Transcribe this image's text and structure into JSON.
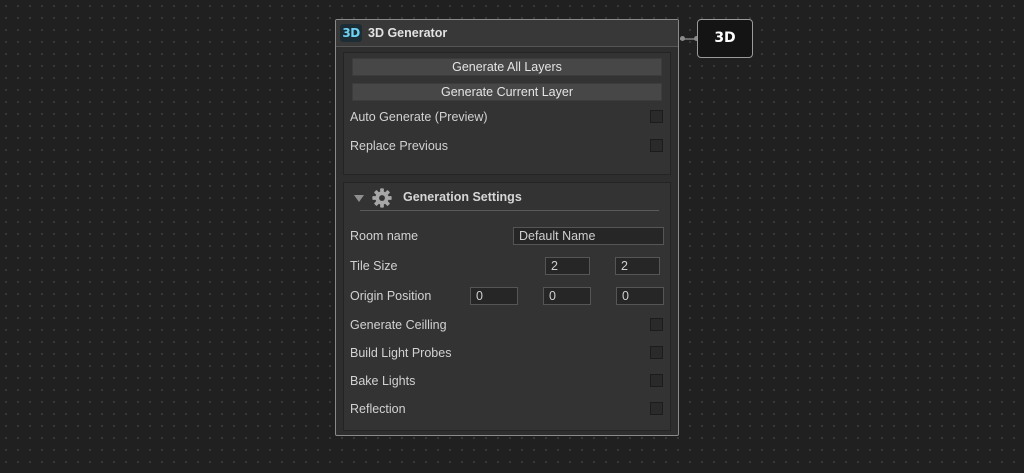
{
  "node": {
    "icon_text": "3D",
    "title": "3D Generator",
    "buttons": {
      "generate_all": "Generate All Layers",
      "generate_current": "Generate Current Layer"
    },
    "toggles": {
      "auto_generate": "Auto Generate (Preview)",
      "replace_previous": "Replace Previous"
    },
    "settings": {
      "title": "Generation Settings",
      "room_name_label": "Room name",
      "room_name_value": "Default Name",
      "tile_size_label": "Tile Size",
      "tile_size_x": "2",
      "tile_size_y": "2",
      "origin_label": "Origin Position",
      "origin_x": "0",
      "origin_y": "0",
      "origin_z": "0",
      "generate_ceiling": "Generate Ceilling",
      "build_light_probes": "Build Light Probes",
      "bake_lights": "Bake Lights",
      "reflection": "Reflection"
    }
  },
  "output_node": {
    "label": "3D"
  },
  "colors": {
    "accent_icon": "#6fd2f5",
    "background": "#202020",
    "panel": "#333333"
  }
}
